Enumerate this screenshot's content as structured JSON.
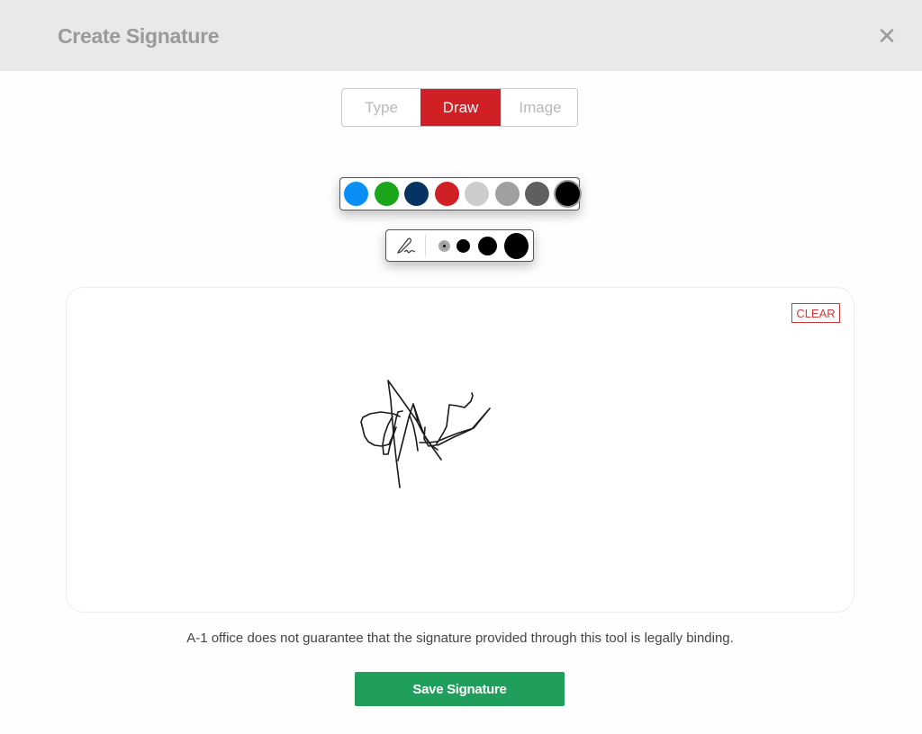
{
  "header": {
    "title": "Create Signature",
    "close_icon": "close-icon",
    "close_glyph": "✕"
  },
  "tabs": [
    {
      "label": "Type",
      "active": false
    },
    {
      "label": "Draw",
      "active": true
    },
    {
      "label": "Image",
      "active": false
    }
  ],
  "palette": {
    "colors": [
      {
        "name": "blue",
        "hex": "#0a8ff7"
      },
      {
        "name": "green",
        "hex": "#1aa51a"
      },
      {
        "name": "navy",
        "hex": "#063462"
      },
      {
        "name": "red",
        "hex": "#d01f25"
      },
      {
        "name": "light-gray",
        "hex": "#cccccc"
      },
      {
        "name": "gray",
        "hex": "#a0a0a0"
      },
      {
        "name": "dark-gray",
        "hex": "#5f5f5f"
      },
      {
        "name": "black",
        "hex": "#000000"
      }
    ],
    "selected": "black"
  },
  "pen_widths": {
    "icon": "pen-signature-icon",
    "options": [
      "extra-small",
      "small",
      "medium",
      "large"
    ],
    "selected": "extra-small"
  },
  "canvas": {
    "clear_label": "CLEAR",
    "stroke_color": "#1a1a1a",
    "has_signature": true
  },
  "disclaimer": "A-1 office does not guarantee that the signature provided through this tool is legally binding.",
  "save_label": "Save Signature",
  "colors": {
    "accent_red": "#d01f25",
    "save_green": "#1f9e5c"
  }
}
